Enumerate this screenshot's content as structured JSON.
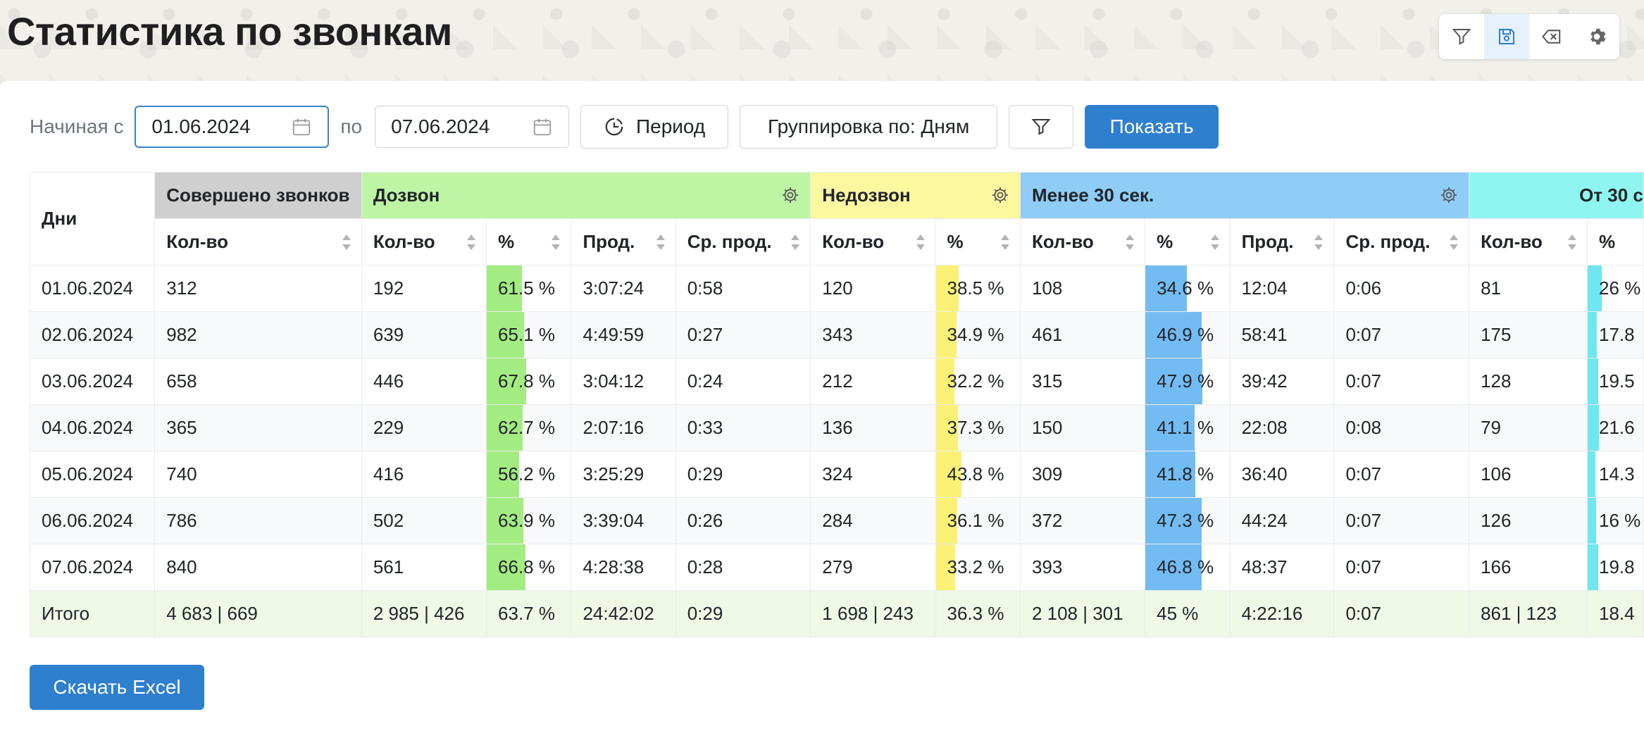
{
  "page": {
    "title": "Статистика по звонкам"
  },
  "toolbar": {
    "icons": [
      "filter-icon",
      "save-icon",
      "clear-icon",
      "gear-icon"
    ]
  },
  "filters": {
    "from_label": "Начиная с",
    "from_value": "01.06.2024",
    "to_label": "по",
    "to_value": "07.06.2024",
    "period_label": "Период",
    "grouping_label": "Группировка по: Дням",
    "show_label": "Показать"
  },
  "table": {
    "row_header": "Дни",
    "groups": {
      "made": "Совершено звонков",
      "reached": "Дозвон",
      "not_reached": "Недозвон",
      "under30": "Менее 30 сек.",
      "from30": "От 30 с"
    },
    "subheaders": {
      "count": "Кол-во",
      "pct": "%",
      "dur": "Прод.",
      "avg": "Ср. прод."
    },
    "rows": [
      {
        "day": "01.06.2024",
        "made": "312",
        "r_cnt": "192",
        "r_pct": "61.5 %",
        "r_pct_val": 61.5,
        "r_dur": "3:07:24",
        "r_avg": "0:58",
        "n_cnt": "120",
        "n_pct": "38.5 %",
        "n_pct_val": 38.5,
        "u_cnt": "108",
        "u_pct": "34.6 %",
        "u_pct_val": 34.6,
        "u_dur": "12:04",
        "u_avg": "0:06",
        "f_cnt": "81",
        "f_pct": "26 %",
        "f_pct_val": 26
      },
      {
        "day": "02.06.2024",
        "made": "982",
        "r_cnt": "639",
        "r_pct": "65.1 %",
        "r_pct_val": 65.1,
        "r_dur": "4:49:59",
        "r_avg": "0:27",
        "n_cnt": "343",
        "n_pct": "34.9 %",
        "n_pct_val": 34.9,
        "u_cnt": "461",
        "u_pct": "46.9 %",
        "u_pct_val": 46.9,
        "u_dur": "58:41",
        "u_avg": "0:07",
        "f_cnt": "175",
        "f_pct": "17.8",
        "f_pct_val": 17.8
      },
      {
        "day": "03.06.2024",
        "made": "658",
        "r_cnt": "446",
        "r_pct": "67.8 %",
        "r_pct_val": 67.8,
        "r_dur": "3:04:12",
        "r_avg": "0:24",
        "n_cnt": "212",
        "n_pct": "32.2 %",
        "n_pct_val": 32.2,
        "u_cnt": "315",
        "u_pct": "47.9 %",
        "u_pct_val": 47.9,
        "u_dur": "39:42",
        "u_avg": "0:07",
        "f_cnt": "128",
        "f_pct": "19.5",
        "f_pct_val": 19.5
      },
      {
        "day": "04.06.2024",
        "made": "365",
        "r_cnt": "229",
        "r_pct": "62.7 %",
        "r_pct_val": 62.7,
        "r_dur": "2:07:16",
        "r_avg": "0:33",
        "n_cnt": "136",
        "n_pct": "37.3 %",
        "n_pct_val": 37.3,
        "u_cnt": "150",
        "u_pct": "41.1 %",
        "u_pct_val": 41.1,
        "u_dur": "22:08",
        "u_avg": "0:08",
        "f_cnt": "79",
        "f_pct": "21.6",
        "f_pct_val": 21.6
      },
      {
        "day": "05.06.2024",
        "made": "740",
        "r_cnt": "416",
        "r_pct": "56.2 %",
        "r_pct_val": 56.2,
        "r_dur": "3:25:29",
        "r_avg": "0:29",
        "n_cnt": "324",
        "n_pct": "43.8 %",
        "n_pct_val": 43.8,
        "u_cnt": "309",
        "u_pct": "41.8 %",
        "u_pct_val": 41.8,
        "u_dur": "36:40",
        "u_avg": "0:07",
        "f_cnt": "106",
        "f_pct": "14.3",
        "f_pct_val": 14.3
      },
      {
        "day": "06.06.2024",
        "made": "786",
        "r_cnt": "502",
        "r_pct": "63.9 %",
        "r_pct_val": 63.9,
        "r_dur": "3:39:04",
        "r_avg": "0:26",
        "n_cnt": "284",
        "n_pct": "36.1 %",
        "n_pct_val": 36.1,
        "u_cnt": "372",
        "u_pct": "47.3 %",
        "u_pct_val": 47.3,
        "u_dur": "44:24",
        "u_avg": "0:07",
        "f_cnt": "126",
        "f_pct": "16 %",
        "f_pct_val": 16
      },
      {
        "day": "07.06.2024",
        "made": "840",
        "r_cnt": "561",
        "r_pct": "66.8 %",
        "r_pct_val": 66.8,
        "r_dur": "4:28:38",
        "r_avg": "0:28",
        "n_cnt": "279",
        "n_pct": "33.2 %",
        "n_pct_val": 33.2,
        "u_cnt": "393",
        "u_pct": "46.8 %",
        "u_pct_val": 46.8,
        "u_dur": "48:37",
        "u_avg": "0:07",
        "f_cnt": "166",
        "f_pct": "19.8",
        "f_pct_val": 19.8
      }
    ],
    "total": {
      "day": "Итого",
      "made": "4 683 | 669",
      "r_cnt": "2 985 | 426",
      "r_pct": "63.7 %",
      "r_dur": "24:42:02",
      "r_avg": "0:29",
      "n_cnt": "1 698 | 243",
      "n_pct": "36.3 %",
      "u_cnt": "2 108 | 301",
      "u_pct": "45 %",
      "u_dur": "4:22:16",
      "u_avg": "0:07",
      "f_cnt": "861 | 123",
      "f_pct": "18.4"
    }
  },
  "actions": {
    "excel_label": "Скачать Excel"
  },
  "colors": {
    "primary": "#2f7fcf",
    "made_header": "#cfcfcf",
    "reached_header": "#bdf5a5",
    "not_reached_header": "#fdf7a0",
    "under30_header": "#8fcdf6",
    "from30_header": "#8ff5f0"
  }
}
